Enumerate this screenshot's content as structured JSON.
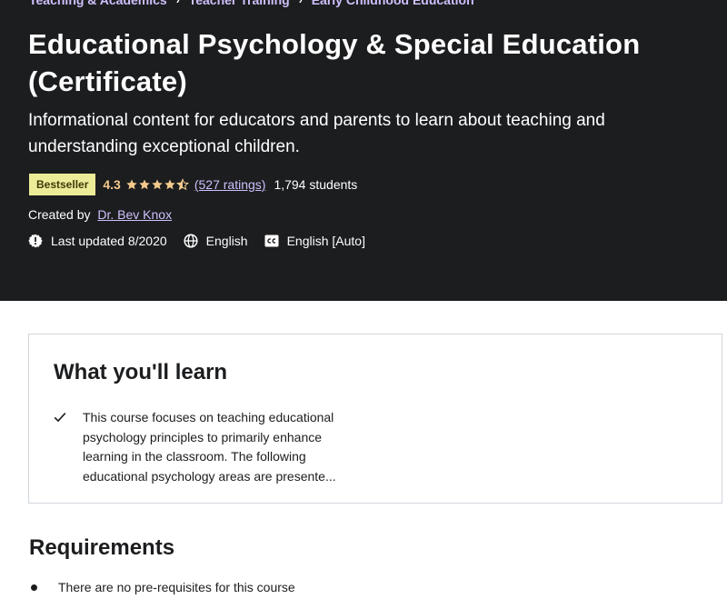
{
  "breadcrumb": {
    "items": [
      "Teaching & Academics",
      "Teacher Training",
      "Early Childhood Education"
    ],
    "separator": "›"
  },
  "course": {
    "title": "Educational Psychology & Special Education (Certificate)",
    "subtitle": "Informational content for educators and parents to learn about teaching and understanding exceptional children.",
    "badge": "Bestseller",
    "rating": "4.3",
    "rating_value": 4.3,
    "rating_max": 5,
    "ratings_count": "(527 ratings)",
    "students": "1,794 students",
    "created_by_label": "Created by",
    "instructor": "Dr. Bev Knox",
    "last_updated": "Last updated 8/2020",
    "language": "English",
    "captions": "English [Auto]"
  },
  "learn": {
    "title": "What you'll learn",
    "items": [
      "This course focuses on teaching educational psychology principles to primarily enhance learning in the classroom. The following educational psychology areas are presente..."
    ]
  },
  "requirements": {
    "title": "Requirements",
    "items": [
      "There are no pre-requisites for this course"
    ]
  },
  "colors": {
    "hero_bg": "#1c1d1f",
    "link": "#cec0fc",
    "badge_bg": "#eceb98",
    "star": "#f3ca8c",
    "border": "#d1d7dc"
  },
  "icons": {
    "star": "star-icon",
    "half_star": "star-half-icon",
    "alert": "alert-icon",
    "globe": "globe-icon",
    "captions": "closed-captions-icon",
    "check": "check-icon"
  }
}
